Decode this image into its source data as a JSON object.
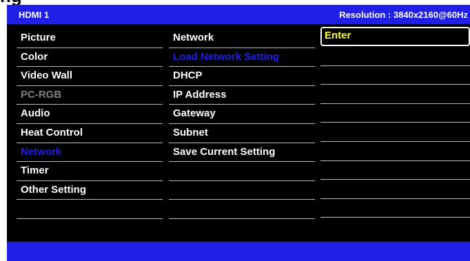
{
  "header": {
    "source": "HDMI 1",
    "resolution": "Resolution : 3840x2160@60Hz"
  },
  "menu": [
    {
      "label": "Picture",
      "state": "normal"
    },
    {
      "label": "Color",
      "state": "normal"
    },
    {
      "label": "Video Wall",
      "state": "normal"
    },
    {
      "label": "PC-RGB",
      "state": "disabled"
    },
    {
      "label": "Audio",
      "state": "normal"
    },
    {
      "label": "Heat Control",
      "state": "normal"
    },
    {
      "label": "Network",
      "state": "selected"
    },
    {
      "label": "Timer",
      "state": "normal"
    },
    {
      "label": "Other Setting",
      "state": "normal"
    },
    {
      "label": "",
      "state": "empty"
    }
  ],
  "submenu": [
    {
      "label": "Network",
      "state": "normal"
    },
    {
      "label": "Load Network Setting",
      "state": "selected"
    },
    {
      "label": "DHCP",
      "state": "normal"
    },
    {
      "label": "IP Address",
      "state": "normal"
    },
    {
      "label": "Gateway",
      "state": "normal"
    },
    {
      "label": "Subnet",
      "state": "normal"
    },
    {
      "label": "Save Current Setting",
      "state": "normal"
    },
    {
      "label": "",
      "state": "empty"
    },
    {
      "label": "",
      "state": "empty"
    },
    {
      "label": "",
      "state": "empty"
    }
  ],
  "value_column": [
    {
      "label": "Enter",
      "state": "focused"
    },
    {
      "label": "",
      "state": "empty"
    },
    {
      "label": "",
      "state": "empty"
    },
    {
      "label": "",
      "state": "empty"
    },
    {
      "label": "",
      "state": "empty"
    },
    {
      "label": "",
      "state": "empty"
    },
    {
      "label": "",
      "state": "empty"
    },
    {
      "label": "",
      "state": "empty"
    },
    {
      "label": "",
      "state": "empty"
    },
    {
      "label": "",
      "state": "empty"
    }
  ],
  "colors": {
    "bar_blue": "#1f1fe6",
    "selected_text": "#1f1fe6",
    "disabled_text": "#808080",
    "focus_text": "#ffff40"
  }
}
